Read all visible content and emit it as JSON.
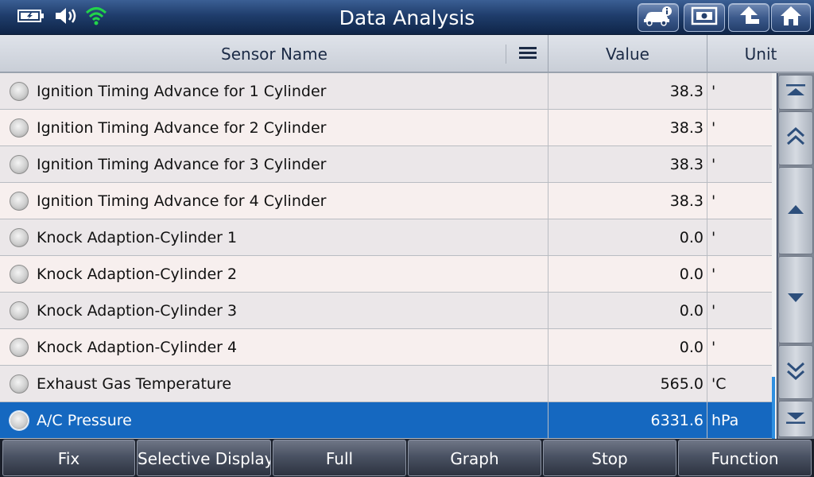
{
  "app": {
    "title": "Data Analysis"
  },
  "status_icons": [
    "battery-icon",
    "speaker-icon",
    "wifi-icon"
  ],
  "toolbar_icons": [
    "vehicle-info-icon",
    "screenshot-icon",
    "back-arrow-icon",
    "home-icon"
  ],
  "columns": {
    "sensor_name": "Sensor Name",
    "value": "Value",
    "unit": "Unit"
  },
  "rows": [
    {
      "name": "Ignition Timing Advance for 1 Cylinder",
      "value": "38.3",
      "unit": "'"
    },
    {
      "name": "Ignition Timing Advance for 2 Cylinder",
      "value": "38.3",
      "unit": "'"
    },
    {
      "name": "Ignition Timing Advance for 3 Cylinder",
      "value": "38.3",
      "unit": "'"
    },
    {
      "name": "Ignition Timing Advance for 4 Cylinder",
      "value": "38.3",
      "unit": "'"
    },
    {
      "name": "Knock Adaption-Cylinder 1",
      "value": "0.0",
      "unit": "'"
    },
    {
      "name": "Knock Adaption-Cylinder 2",
      "value": "0.0",
      "unit": "'"
    },
    {
      "name": "Knock Adaption-Cylinder 3",
      "value": "0.0",
      "unit": "'"
    },
    {
      "name": "Knock Adaption-Cylinder 4",
      "value": "0.0",
      "unit": "'"
    },
    {
      "name": "Exhaust Gas Temperature",
      "value": "565.0",
      "unit": "'C"
    },
    {
      "name": "A/C Pressure",
      "value": "6331.6",
      "unit": "hPa"
    }
  ],
  "selected_row_index": 9,
  "scroll_position": {
    "start_fraction": 0.83,
    "end_fraction": 1.0
  },
  "bottom_buttons": {
    "fix": "Fix",
    "selective_display": "Selective Display",
    "full": "Full",
    "graph": "Graph",
    "stop": "Stop",
    "function": "Function"
  },
  "colors": {
    "selected_row": "#1568c0",
    "scroll_indicator": "#2f8fe0",
    "wifi": "#22d34a"
  }
}
